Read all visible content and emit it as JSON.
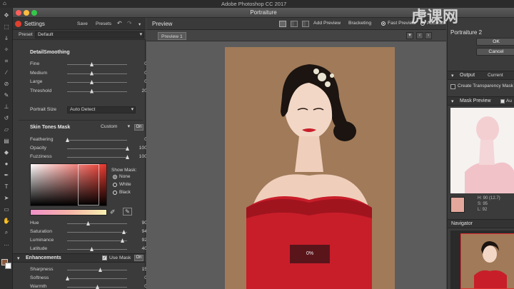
{
  "os": {
    "app_title": "Adobe Photoshop CC 2017"
  },
  "watermark": "虎课网",
  "window": {
    "title": "Portraiture",
    "plugin_label": "Portraiture 2"
  },
  "settings": {
    "title": "Settings",
    "save": "Save",
    "presets": "Presets",
    "preset_label": "Preset",
    "preset_value": "Default",
    "detail": {
      "title": "DetailSmoothing",
      "rows": [
        {
          "name": "Fine",
          "value": "0",
          "level": 0.4
        },
        {
          "name": "Medium",
          "value": "0",
          "level": 0.4
        },
        {
          "name": "Large",
          "value": "0",
          "level": 0.4
        },
        {
          "name": "Threshold",
          "value": "20",
          "level": 0.4
        }
      ],
      "portrait_size_label": "Portrait Size",
      "portrait_size_value": "Auto Detect"
    },
    "skin": {
      "title": "Skin Tones Mask",
      "mode": "Custom",
      "on": "On",
      "feathering": {
        "name": "Feathering",
        "value": "0",
        "level": 0.0
      },
      "opacity": {
        "name": "Opacity",
        "value": "100",
        "unit": "%",
        "level": 1.0
      },
      "fuzziness": {
        "name": "Fuzziness",
        "value": "100",
        "unit": "%",
        "level": 1.0
      },
      "show_mask_label": "Show Mask:",
      "mask_options": [
        "None",
        "White",
        "Black"
      ],
      "hue": {
        "name": "Hue",
        "value": "90",
        "level": 0.35
      },
      "saturation": {
        "name": "Saturation",
        "value": "94",
        "level": 0.94
      },
      "luminance": {
        "name": "Luminance",
        "value": "92",
        "level": 0.92
      },
      "latitude": {
        "name": "Latitude",
        "value": "40",
        "level": 0.4
      }
    },
    "enh": {
      "title": "Enhancements",
      "use_mask": "Use Mask",
      "on": "On",
      "rows": [
        {
          "name": "Sharpness",
          "value": "15",
          "level": 0.55
        },
        {
          "name": "Softness",
          "value": "0",
          "level": 0.0
        },
        {
          "name": "Warmth",
          "value": "0",
          "level": 0.5
        },
        {
          "name": "Tint",
          "value": "0",
          "level": 0.5
        }
      ]
    }
  },
  "preview": {
    "title": "Preview",
    "add_preview": "Add Preview",
    "bracketing": "Bracketing",
    "fast_preview": "Fast Preview",
    "accurate": "Accurate",
    "tab": "Preview 1",
    "progress": "0%"
  },
  "right": {
    "ok": "OK",
    "cancel": "Cancel",
    "output_title": "Output",
    "output_value": "Current",
    "create_transparency": "Create Transparency Mask",
    "mask_preview_title": "Mask Preview",
    "mask_preview_auto": "Au",
    "hsl": {
      "h": "H: 90 (12.7)",
      "s": "S: 95",
      "l": "L: 92"
    },
    "navigator_title": "Navigator"
  },
  "colors": {
    "skin_swatch": "#e3a89b",
    "dress": "#c81e2a",
    "background": "#a07a59"
  }
}
